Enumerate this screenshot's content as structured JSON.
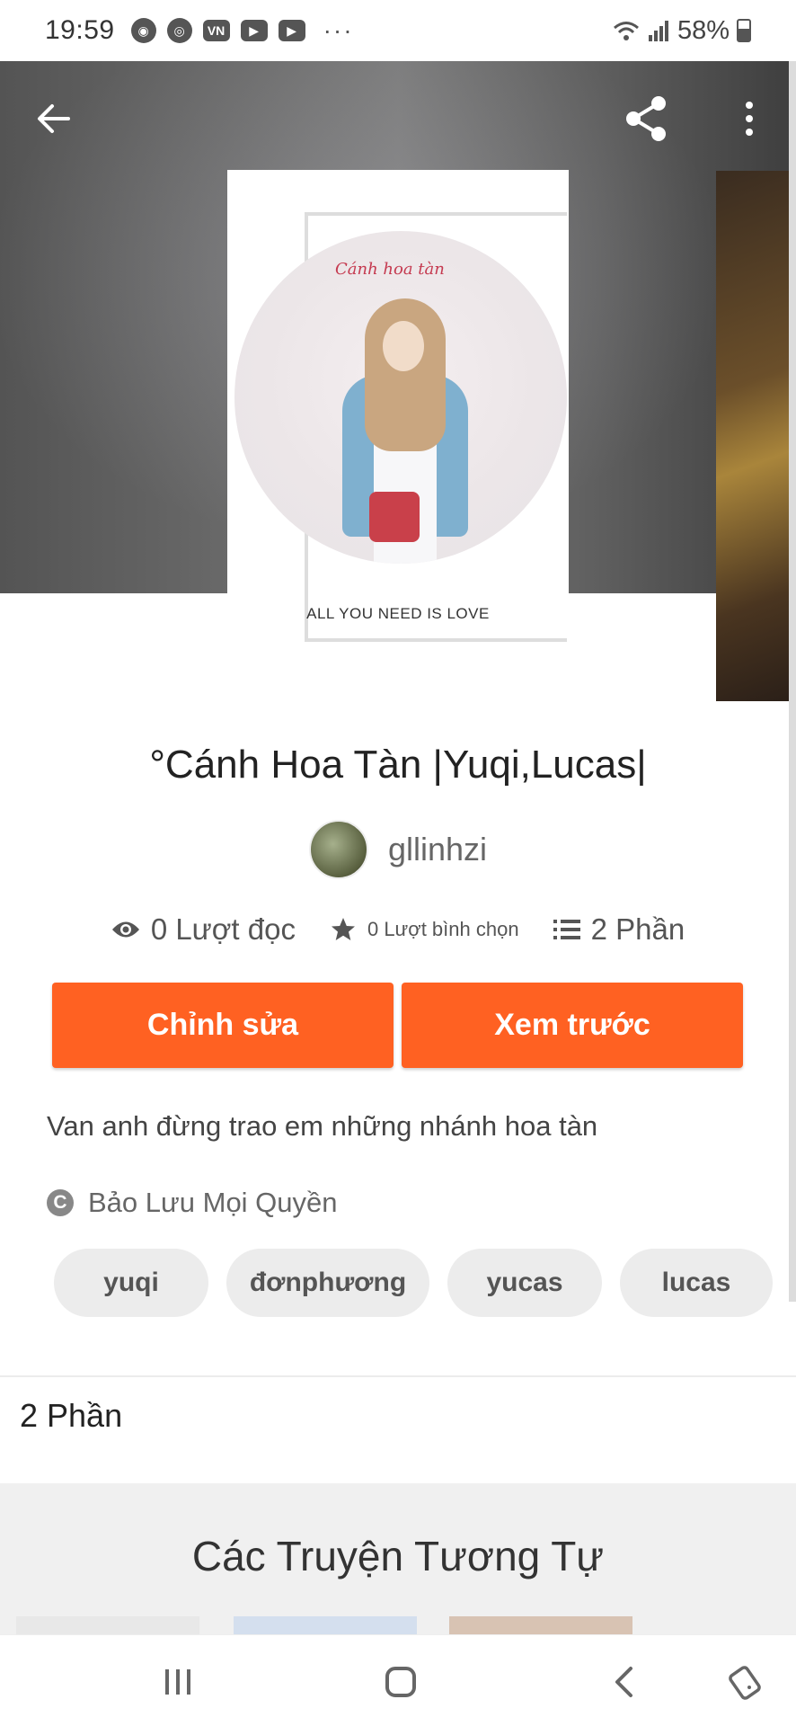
{
  "status_bar": {
    "time": "19:59",
    "battery": "58%",
    "icons": [
      "camera-icon",
      "eye-icon",
      "vn-app-icon",
      "youtube-icon",
      "youtube-icon",
      "more-dots-icon",
      "wifi-icon",
      "signal-icon",
      "battery-icon"
    ],
    "dots": "···"
  },
  "header": {
    "back_icon": "arrow-left-icon",
    "share_icon": "share-icon",
    "more_icon": "more-vertical-icon"
  },
  "cover": {
    "script_title": "Cánh hoa tàn",
    "caption": "ALL YOU NEED IS LOVE"
  },
  "story": {
    "title": "°Cánh Hoa Tàn |Yuqi,Lucas|",
    "author": "gllinhzi",
    "reads": "0 Lượt đọc",
    "votes": "0 Lượt bình chọn",
    "parts": "2 Phần",
    "description": "Van anh đừng trao em những nhánh hoa tàn",
    "copyright": "Bảo Lưu Mọi Quyền",
    "copyright_symbol": "C",
    "tags": [
      "yuqi",
      "đơnphương",
      "yucas",
      "lucas"
    ]
  },
  "actions": {
    "edit_label": "Chỉnh sửa",
    "preview_label": "Xem trước"
  },
  "parts_section": {
    "label": "2 Phần"
  },
  "similar": {
    "title": "Các Truyện Tương Tự"
  },
  "colors": {
    "accent": "#ff6122",
    "tag_bg": "#ececec",
    "similar_bg": "#f0f0f0"
  }
}
